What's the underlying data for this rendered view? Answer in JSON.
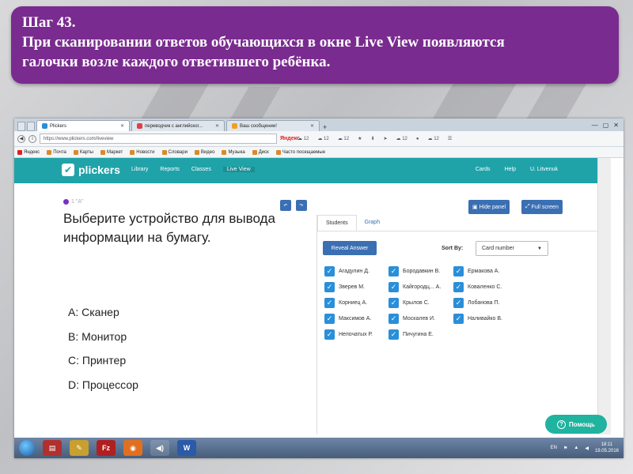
{
  "banner": {
    "line1": "Шаг 43.",
    "line2": "При сканировании ответов обучающихся в окне Live View появляются",
    "line3": "галочки возле каждого ответившего ребёнка."
  },
  "browser": {
    "tabs": [
      {
        "label": "Plickers",
        "color": "#2a8fd8"
      },
      {
        "label": "переводчик с английског...",
        "color": "#e04040"
      },
      {
        "label": "Ваш сообщение!",
        "color": "#f0a020"
      }
    ],
    "url": "https://www.plickers.com/liveview",
    "search_engine": "Яндекс",
    "weather_values": [
      "12",
      "12",
      "12",
      "12",
      "12"
    ],
    "bookmarks": [
      "Яндекс",
      "Почта",
      "Карты",
      "Маркет",
      "Новости",
      "Словари",
      "Видео",
      "Музыка",
      "Диск",
      "Часто посещаемые"
    ]
  },
  "app": {
    "logo": "plickers",
    "nav": [
      "Library",
      "Reports",
      "Classes",
      "Live View"
    ],
    "nav_right": [
      "Cards",
      "Help",
      "U. Litvenuk"
    ],
    "question_tag": "1 \"A\"",
    "question": "Выберите устройство для вывода информации на бумагу.",
    "answers": [
      "A: Сканер",
      "B: Монитор",
      "C: Принтер",
      "D: Процессор"
    ],
    "hide_panel": "Hide panel",
    "full_screen": "Full screen",
    "panel_tabs": [
      "Students",
      "Graph"
    ],
    "reveal_answer": "Reveal Answer",
    "sort_label": "Sort By:",
    "sort_value": "Card number",
    "students": [
      "Агадулин Д.",
      "Бородавкин В.",
      "Ермакова А.",
      "Зверев М.",
      "Кайгородц... А.",
      "Коваленко С.",
      "Корниец А.",
      "Крылов С.",
      "Лобанова П.",
      "Максимов А.",
      "Москалев И.",
      "Наливайко В.",
      "Непочатых Р.",
      "Пичугина Е."
    ],
    "help_button": "Помощь"
  },
  "taskbar": {
    "lang": "EN",
    "time": "18:11",
    "date": "19.05.2016"
  }
}
